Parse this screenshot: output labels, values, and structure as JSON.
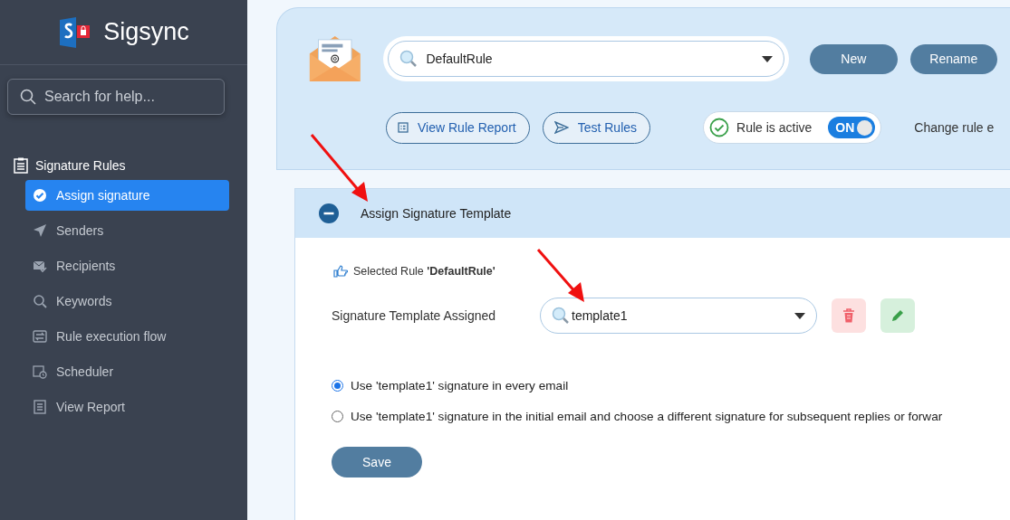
{
  "brand": {
    "name": "Sigsync"
  },
  "help_search": {
    "placeholder": "Search for help..."
  },
  "nav": {
    "section": "Signature Rules",
    "items": [
      {
        "label": "Assign signature",
        "selected": true
      },
      {
        "label": "Senders",
        "selected": false
      },
      {
        "label": "Recipients",
        "selected": false
      },
      {
        "label": "Keywords",
        "selected": false
      },
      {
        "label": "Rule execution flow",
        "selected": false
      },
      {
        "label": "Scheduler",
        "selected": false
      },
      {
        "label": "View Report",
        "selected": false
      }
    ]
  },
  "header": {
    "rule_select": {
      "value": "DefaultRule"
    },
    "buttons": [
      "New",
      "Rename"
    ],
    "actions": [
      "View Rule Report",
      "Test Rules"
    ],
    "active_toggle": {
      "label": "Rule is active",
      "on": true,
      "state_text": "ON"
    },
    "change_rule_text": "Change rule e"
  },
  "panel": {
    "title": "Assign Signature Template",
    "expanded": true,
    "selected_rule": "Selected Rule **'DefaultRule'**",
    "template_label": "Signature Template Assigned",
    "template_select": {
      "value": "template1"
    },
    "options": [
      {
        "label": "Use 'template1' signature in every email",
        "selected": true
      },
      {
        "label": "Use 'template1' signature in the initial email and choose a different signature for subsequent replies or forwar",
        "selected": false
      }
    ],
    "save": "Save"
  }
}
